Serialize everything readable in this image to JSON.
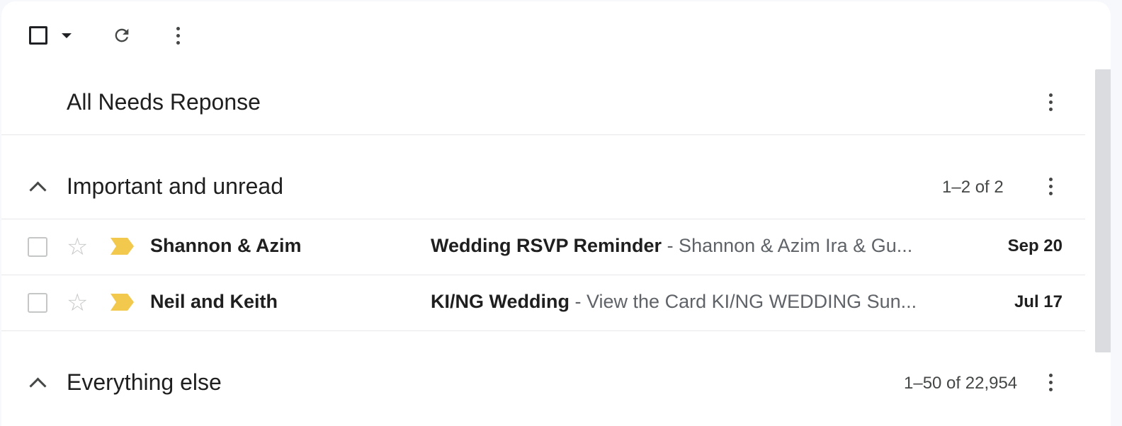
{
  "toolbar": {
    "select_icon": "checkbox-icon",
    "dropdown_icon": "caret-down-icon",
    "refresh_icon": "refresh-icon",
    "more_icon": "more-vert-icon"
  },
  "sections": {
    "needs_response": {
      "title": "All Needs Reponse"
    },
    "important": {
      "title": "Important and unread",
      "count": "1–2 of 2"
    },
    "everything_else": {
      "title": "Everything else",
      "count": "1–50 of 22,954"
    }
  },
  "emails": [
    {
      "sender": "Shannon & Azim",
      "subject": "Wedding RSVP Reminder",
      "snippet": " - Shannon & Azim Ira & Gu...",
      "date": "Sep 20"
    },
    {
      "sender": "Neil and Keith",
      "subject": "KI/NG Wedding",
      "snippet": " - View the Card KI/NG WEDDING Sun...",
      "date": "Jul 17"
    }
  ],
  "colors": {
    "important_marker": "#f2c94c",
    "star_outline": "#c4c7c5"
  }
}
